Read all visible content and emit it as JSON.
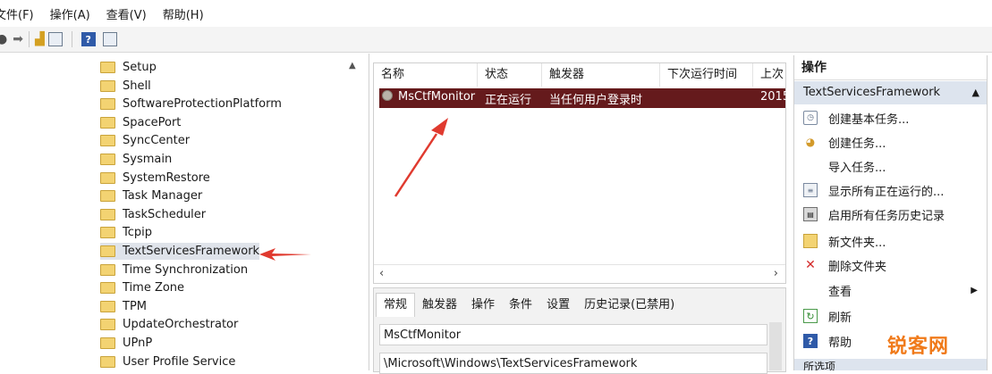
{
  "menu": {
    "file": "文件(F)",
    "action": "操作(A)",
    "view": "查看(V)",
    "help": "帮助(H)"
  },
  "toolbar": {
    "help_glyph": "?"
  },
  "tree": {
    "items": [
      "Setup",
      "Shell",
      "SoftwareProtectionPlatform",
      "SpacePort",
      "SyncCenter",
      "Sysmain",
      "SystemRestore",
      "Task Manager",
      "TaskScheduler",
      "Tcpip",
      "TextServicesFramework",
      "Time Synchronization",
      "Time Zone",
      "TPM",
      "UpdateOrchestrator",
      "UPnP",
      "User Profile Service"
    ],
    "selected": "TextServicesFramework"
  },
  "tasklist": {
    "columns": [
      "名称",
      "状态",
      "触发器",
      "下次运行时间",
      "上次"
    ],
    "row": {
      "name": "MsCtfMonitor",
      "status": "正在运行",
      "trigger": "当任何用户登录时",
      "last": "2015"
    }
  },
  "detail": {
    "tabs": [
      "常规",
      "触发器",
      "操作",
      "条件",
      "设置",
      "历史记录(已禁用)"
    ],
    "name_value": "MsCtfMonitor",
    "path_value": "\\Microsoft\\Windows\\TextServicesFramework"
  },
  "actions": {
    "title": "操作",
    "section": "TextServicesFramework",
    "items": [
      "创建基本任务...",
      "创建任务...",
      "导入任务...",
      "显示所有正在运行的...",
      "启用所有任务历史记录",
      "新文件夹...",
      "删除文件夹",
      "查看",
      "刷新",
      "帮助"
    ],
    "bottom_section": "所选项"
  },
  "watermark": "锐客网",
  "colors": {
    "selected_row": "#651a1c",
    "section_bg": "#dde4ee",
    "arrow": "#e03a2f"
  }
}
